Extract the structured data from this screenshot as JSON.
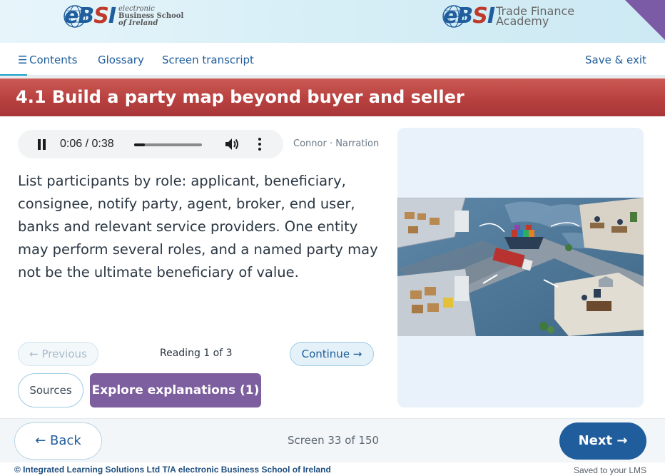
{
  "header": {
    "left_logo": {
      "mark": "eBSI",
      "line1": "electronic",
      "line2": "Business School",
      "line3": "of Ireland"
    },
    "right_logo": {
      "mark": "eBSI",
      "line1": "Trade Finance",
      "line2": "Academy"
    },
    "corner_color": "#7b5aa6"
  },
  "nav": {
    "contents": "Contents",
    "glossary": "Glossary",
    "transcript": "Screen transcript",
    "save_exit": "Save & exit"
  },
  "page": {
    "title": "4.1 Build a party map beyond buyer and seller",
    "body": "List participants by role: applicant, beneficiary, consignee, notify party, agent, broker, end user, banks and relevant service providers. One entity may perform several roles, and a named party may not be the ultimate beneficiary of value."
  },
  "audio": {
    "time": "0:06 / 0:38",
    "progress_fraction": 0.16,
    "narrator": "Connor · Narration"
  },
  "reading": {
    "previous": "← Previous",
    "status": "Reading 1 of 3",
    "continue": "Continue →"
  },
  "actions": {
    "sources": "Sources",
    "explore": "Explore explanations (1)"
  },
  "footer": {
    "back": "← Back",
    "screen_count": "Screen 33 of 150",
    "next": "Next →",
    "copyright": "© Integrated Learning Solutions Ltd T/A electronic Business School of Ireland",
    "saved": "Saved to your LMS"
  },
  "colors": {
    "brand_blue": "#1f5d9c",
    "banner_red": "#b8413f",
    "explore_purple": "#7d5e9e"
  },
  "icons": [
    "menu-icon",
    "pause-icon",
    "volume-icon",
    "more-vert-icon"
  ]
}
